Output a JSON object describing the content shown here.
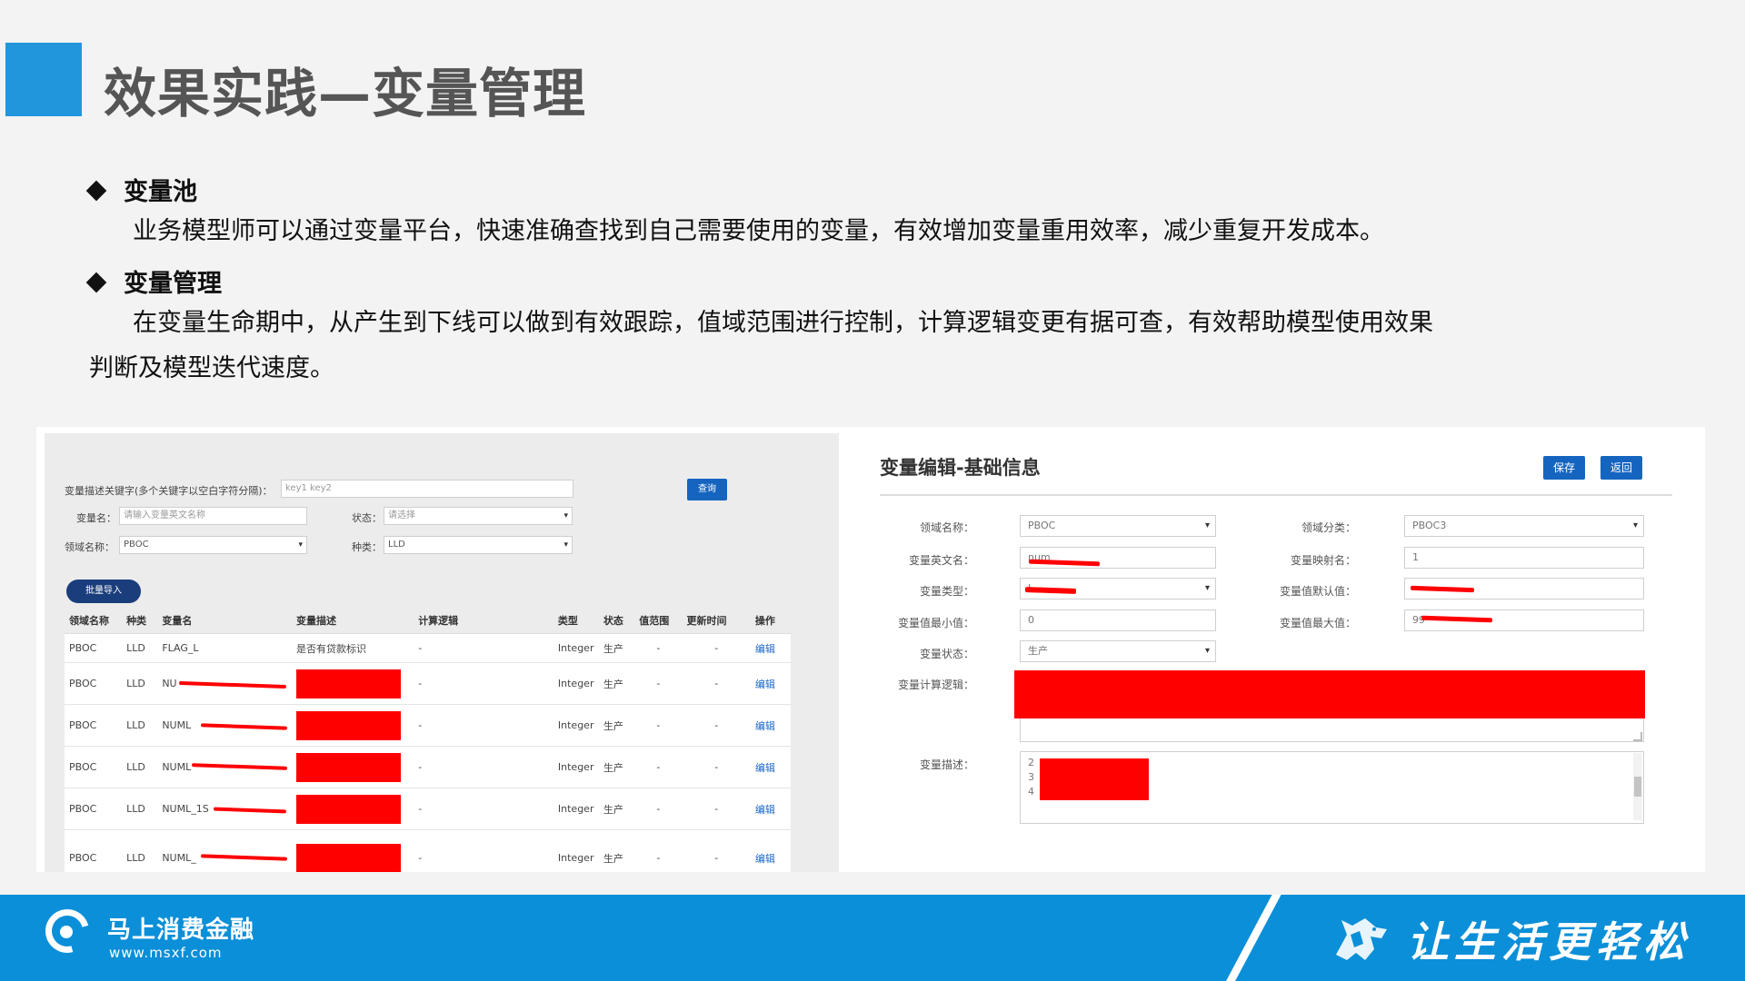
{
  "slide": {
    "title": "效果实践—变量管理",
    "bullets": [
      {
        "heading": "变量池",
        "text": "业务模型师可以通过变量平台，快速准确查找到自己需要使用的变量，有效增加变量重用效率，减少重复开发成本。"
      },
      {
        "heading": "变量管理",
        "text_line1": "在变量生命期中，从产生到下线可以做到有效跟踪，值域范围进行控制，计算逻辑变更有据可查，有效帮助模型使用效果",
        "text_line2": "判断及模型迭代速度。"
      }
    ]
  },
  "search": {
    "keyword_label": "变量描述关键字(多个关键字以空白字符分隔)：",
    "keyword_value": "key1 key2",
    "query_button": "查询",
    "varname_label": "变量名：",
    "varname_placeholder": "请输入变量英文名称",
    "status_label": "状态：",
    "status_value": "请选择",
    "domain_label": "领域名称：",
    "domain_value": "PBOC",
    "kind_label": "种类：",
    "kind_value": "LLD",
    "batch_import_button": "批量导入"
  },
  "table": {
    "headers": [
      "领域名称",
      "种类",
      "变量名",
      "变量描述",
      "计算逻辑",
      "类型",
      "状态",
      "值范围",
      "更新时间",
      "操作"
    ],
    "rows": [
      {
        "domain": "PBOC",
        "kind": "LLD",
        "name": "FLAG_L",
        "desc": "是否有贷款标识",
        "logic": "-",
        "type": "Integer",
        "status": "生产",
        "range": "-",
        "updated": "-",
        "action": "编辑"
      },
      {
        "domain": "PBOC",
        "kind": "LLD",
        "name": "NU",
        "desc": "",
        "logic": "-",
        "type": "Integer",
        "status": "生产",
        "range": "-",
        "updated": "-",
        "action": "编辑"
      },
      {
        "domain": "PBOC",
        "kind": "LLD",
        "name": "NUML",
        "desc": "",
        "logic": "-",
        "type": "Integer",
        "status": "生产",
        "range": "-",
        "updated": "-",
        "action": "编辑"
      },
      {
        "domain": "PBOC",
        "kind": "LLD",
        "name": "NUML",
        "desc": "",
        "logic": "-",
        "type": "Integer",
        "status": "生产",
        "range": "-",
        "updated": "-",
        "action": "编辑"
      },
      {
        "domain": "PBOC",
        "kind": "LLD",
        "name": "NUML_1S",
        "desc": "",
        "logic": "-",
        "type": "Integer",
        "status": "生产",
        "range": "-",
        "updated": "-",
        "action": "编辑"
      },
      {
        "domain": "PBOC",
        "kind": "LLD",
        "name": "NUML_",
        "desc": "",
        "logic": "-",
        "type": "Integer",
        "status": "生产",
        "range": "-",
        "updated": "-",
        "action": "编辑"
      }
    ]
  },
  "editor": {
    "title": "变量编辑-基础信息",
    "save_button": "保存",
    "back_button": "返回",
    "domain_label": "领域名称：",
    "domain_value": "PBOC",
    "category_label": "领域分类：",
    "category_value": "PBOC3",
    "en_name_label": "变量英文名：",
    "en_name_value": "num",
    "map_name_label": "变量映射名：",
    "map_name_value": "1",
    "type_label": "变量类型：",
    "type_value": "I",
    "default_label": "变量值默认值：",
    "default_value": "",
    "min_label": "变量值最小值：",
    "min_value": "0",
    "max_label": "变量值最大值：",
    "max_value": "99",
    "status_label": "变量状态：",
    "status_value": "生产",
    "logic_label": "变量计算逻辑：",
    "desc_label": "变量描述：",
    "desc_lines": [
      "2",
      "3",
      "4"
    ]
  },
  "footer": {
    "brand": "马上消费金融",
    "url": "www.msxf.com",
    "slogan": "让生活更轻松"
  },
  "colors": {
    "accent": "#2196dc",
    "footer": "#0b8fd8",
    "redaction": "#ff0000",
    "button": "#1565c0"
  }
}
